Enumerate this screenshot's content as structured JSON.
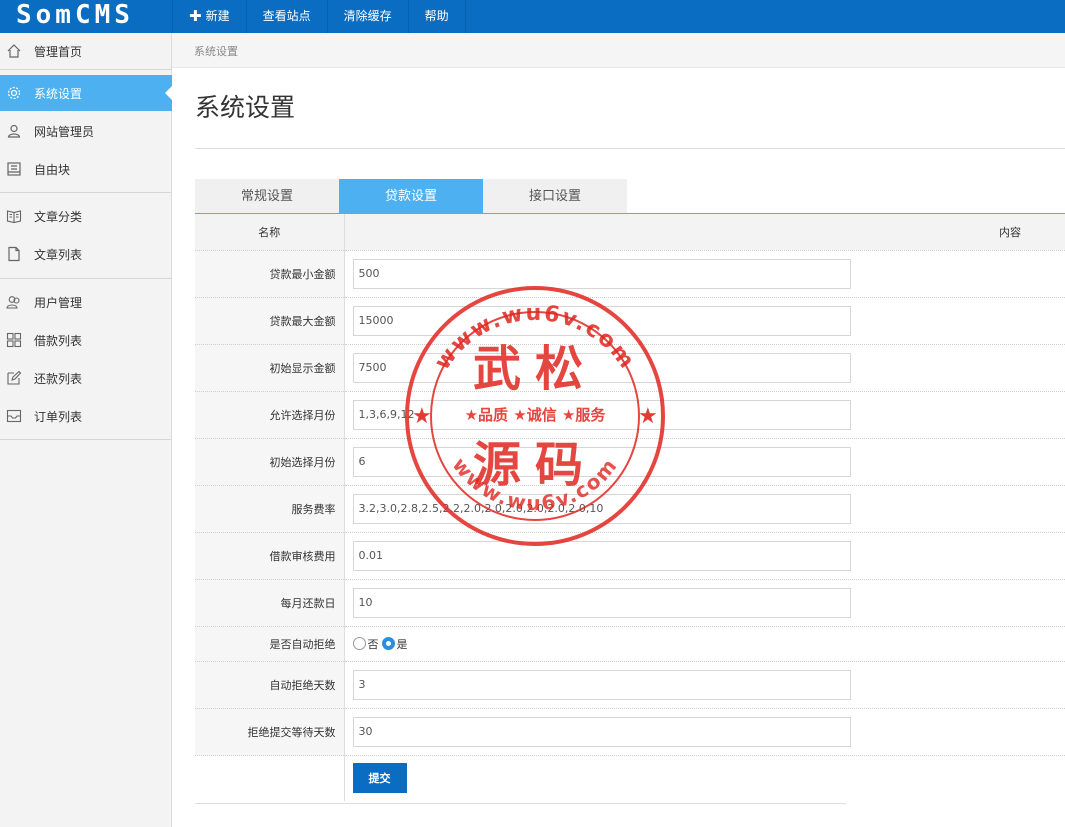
{
  "app": {
    "logo": "SomCMS"
  },
  "topnav": {
    "new_label": "新建",
    "view_site": "查看站点",
    "clear_cache": "清除缓存",
    "help": "帮助"
  },
  "sidebar": {
    "items": [
      {
        "label": "管理首页",
        "icon": "home-icon"
      },
      {
        "label": "系统设置",
        "icon": "gear-icon",
        "active": true
      },
      {
        "label": "网站管理员",
        "icon": "user-icon"
      },
      {
        "label": "自由块",
        "icon": "block-icon"
      },
      {
        "label": "文章分类",
        "icon": "book-icon"
      },
      {
        "label": "文章列表",
        "icon": "file-icon"
      },
      {
        "label": "用户管理",
        "icon": "users-icon"
      },
      {
        "label": "借款列表",
        "icon": "grid-icon"
      },
      {
        "label": "还款列表",
        "icon": "edit-icon"
      },
      {
        "label": "订单列表",
        "icon": "inbox-icon"
      }
    ]
  },
  "breadcrumb": "系统设置",
  "page_title": "系统设置",
  "tabs": [
    "常规设置",
    "贷款设置",
    "接口设置"
  ],
  "table": {
    "col_name": "名称",
    "col_content": "内容",
    "rows": [
      {
        "label": "贷款最小金额",
        "value": "500"
      },
      {
        "label": "贷款最大金额",
        "value": "15000"
      },
      {
        "label": "初始显示金额",
        "value": "7500"
      },
      {
        "label": "允许选择月份",
        "value": "1,3,6,9,12"
      },
      {
        "label": "初始选择月份",
        "value": "6"
      },
      {
        "label": "服务费率",
        "value": "3.2,3.0,2.8,2.5,2.2,2.0,2.0,2.0,2.0,2.0,2.0,10"
      },
      {
        "label": "借款审核费用",
        "value": "0.01"
      },
      {
        "label": "每月还款日",
        "value": "10"
      }
    ],
    "radio_row": {
      "label": "是否自动拒绝",
      "option_no": "否",
      "option_yes": "是",
      "selected": "是"
    },
    "rows2": [
      {
        "label": "自动拒绝天数",
        "value": "3"
      },
      {
        "label": "拒绝提交等待天数",
        "value": "30"
      }
    ],
    "submit_label": "提交"
  },
  "stamp": {
    "top_text": "www.wu6v.com",
    "bottom_text": "www.wu6v.com",
    "line1": "武松",
    "line2": "源码",
    "middle": "★品质 ★诚信 ★服务",
    "color": "#e0261f"
  },
  "colors": {
    "brand": "#0a6dc2",
    "accent": "#4db0f0"
  }
}
